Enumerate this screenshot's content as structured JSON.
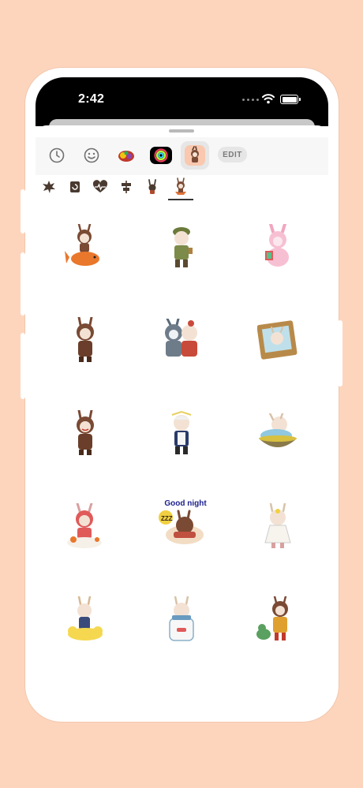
{
  "status_bar": {
    "time": "2:42"
  },
  "category_bar": {
    "items": [
      {
        "name": "recent-icon"
      },
      {
        "name": "emoji-icon"
      },
      {
        "name": "sticker-pack-icon"
      },
      {
        "name": "activity-rings-icon"
      },
      {
        "name": "labubu-pack-icon",
        "selected": true
      }
    ],
    "edit_label": "EDIT"
  },
  "subcategory_bar": {
    "items": [
      "burst-icon",
      "sticker-icon",
      "heart-pulse-icon",
      "align-icon",
      "bunny-icon",
      "labubu-sticker-icon"
    ],
    "selected_index": 5
  },
  "stickers": {
    "caption": "Good night",
    "items": [
      "labubu-riding-goldfish",
      "labubu-soldier-green",
      "labubu-pink-dino",
      "labubu-brown-standing",
      "labubu-shark-hugging",
      "labubu-framed-picture",
      "labubu-brown-smiling",
      "labubu-maid-costume",
      "labubu-sleeping-bowl",
      "labubu-bubble-bath",
      "labubu-good-night-sleeping",
      "labubu-white-dress",
      "labubu-on-cloud",
      "labubu-in-jar",
      "labubu-with-dino-friend"
    ]
  },
  "colors": {
    "background": "#fdd5bd",
    "accent": "#f9c8ae"
  }
}
